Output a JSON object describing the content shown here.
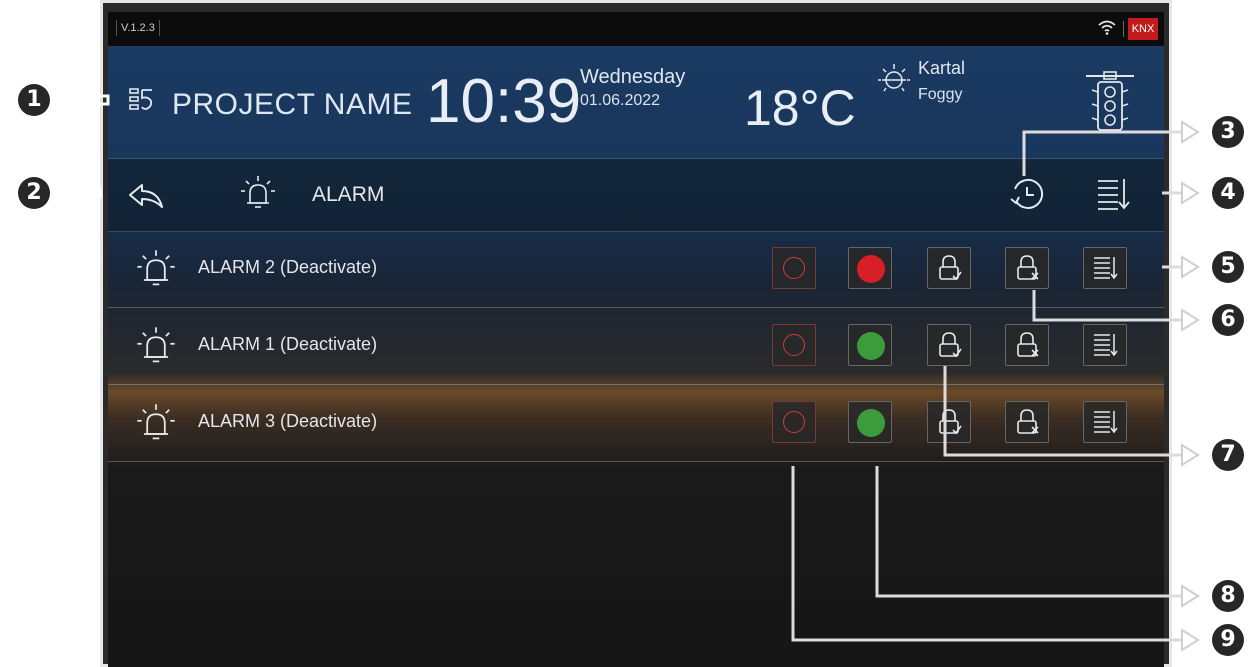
{
  "statusbar": {
    "version": "V.1.2.3",
    "knx": "KNX",
    "wifi_icon": "wifi-icon"
  },
  "header": {
    "project_name": "PROJECT NAME",
    "time": "10:39",
    "day": "Wednesday",
    "date": "01.06.2022",
    "temperature": "18°C",
    "city": "Kartal",
    "weather": "Foggy"
  },
  "titlebar": {
    "title": "ALARM"
  },
  "alarms": [
    {
      "label": "ALARM 2 (Deactivate)",
      "status_color": "#d61f26"
    },
    {
      "label": "ALARM 1  (Deactivate)",
      "status_color": "#3c9c3c"
    },
    {
      "label": "ALARM 3 (Deactivate)",
      "status_color": "#3c9c3c"
    }
  ],
  "callouts": [
    "1",
    "2",
    "3",
    "4",
    "5",
    "6",
    "7",
    "8",
    "9"
  ],
  "colors": {
    "knx_red": "#c11b1b",
    "alarm_active": "#d61f26",
    "alarm_ok": "#3c9c3c",
    "callout_dark": "#272727"
  }
}
